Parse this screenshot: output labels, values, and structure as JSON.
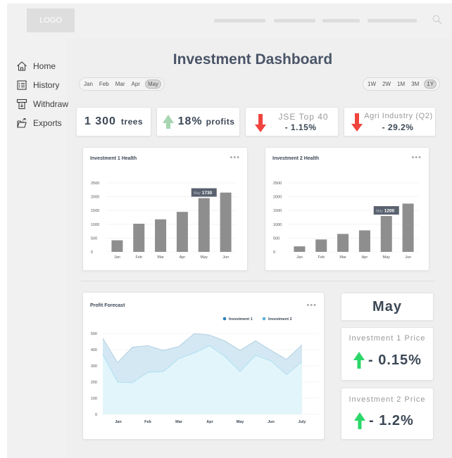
{
  "header": {
    "logo_text": "LOGO"
  },
  "sidebar": {
    "items": [
      {
        "label": "Home",
        "icon": "home-icon"
      },
      {
        "label": "History",
        "icon": "history-icon"
      },
      {
        "label": "Withdraw",
        "icon": "withdraw-icon"
      },
      {
        "label": "Exports",
        "icon": "export-icon"
      }
    ]
  },
  "main": {
    "title": "Investment Dashboard",
    "months": [
      "Jan",
      "Feb",
      "Mar",
      "Apr",
      "May"
    ],
    "active_month": "May",
    "ranges": [
      "1W",
      "2W",
      "1M",
      "3M",
      "1Y"
    ],
    "active_range": "1Y"
  },
  "stats": {
    "trees": {
      "value": "1 300",
      "label": "trees"
    },
    "profits": {
      "value": "18%",
      "label": "profits"
    },
    "jse": {
      "title": "JSE Top 40",
      "value": "- 1.15%"
    },
    "agri": {
      "title": "Agri Industry (Q2)",
      "value": "- 29.2%"
    }
  },
  "colors": {
    "up_arrow_light": "#a8d5b1",
    "up_arrow_green": "#2bd768",
    "down_arrow_red": "#f0443e",
    "bar_gray": "#8e8e8e",
    "tooltip_bg": "#5a6270",
    "investment1": "#2f7fb6",
    "investment2": "#5ab0d8"
  },
  "forecast_month": "May",
  "prices": {
    "inv1": {
      "title": "Investment 1 Price",
      "value": "- 0.15%"
    },
    "inv2": {
      "title": "Investment 2 Price",
      "value": "- 1.2%"
    }
  },
  "chart_data": [
    {
      "type": "bar",
      "title": "Investment 1 Health",
      "categories": [
        "Jan",
        "Feb",
        "Mar",
        "Apr",
        "May",
        "Jun"
      ],
      "values": [
        420,
        1020,
        1180,
        1450,
        1950,
        2150
      ],
      "ylim": [
        0,
        2500
      ],
      "yticks": [
        0,
        500,
        1000,
        1500,
        2000,
        2500
      ],
      "tooltip": {
        "category": "May",
        "label": "May",
        "value": "1730"
      }
    },
    {
      "type": "bar",
      "title": "Investment 2 Health",
      "categories": [
        "Jan",
        "Feb",
        "Mar",
        "Apr",
        "May",
        "Jun"
      ],
      "values": [
        200,
        450,
        650,
        780,
        1300,
        1750
      ],
      "ylim": [
        0,
        2500
      ],
      "yticks": [
        0,
        500,
        1000,
        1500,
        2000,
        2500
      ],
      "tooltip": {
        "category": "May",
        "label": "May",
        "value": "1200"
      }
    },
    {
      "type": "area",
      "title": "Profit Forecast",
      "x_ticks": [
        "Jan",
        "Feb",
        "Mar",
        "Apr",
        "May",
        "Jun",
        "July"
      ],
      "ylim": [
        0,
        500
      ],
      "yticks": [
        0,
        100,
        200,
        300,
        400,
        500
      ],
      "legend": "top-right",
      "series": [
        {
          "name": "Investment 1",
          "x": [
            0,
            0.5,
            1,
            1.5,
            2,
            2.5,
            3,
            3.5,
            4,
            4.5,
            5,
            5.5,
            6,
            6.5
          ],
          "values": [
            470,
            320,
            415,
            425,
            395,
            420,
            500,
            490,
            455,
            395,
            455,
            395,
            340,
            430
          ]
        },
        {
          "name": "Investment 2",
          "x": [
            0,
            0.5,
            1,
            1.5,
            2,
            2.5,
            3,
            3.5,
            4,
            4.5,
            5,
            5.5,
            6,
            6.5
          ],
          "values": [
            370,
            200,
            195,
            260,
            265,
            345,
            380,
            425,
            360,
            265,
            365,
            330,
            245,
            325
          ]
        }
      ]
    }
  ]
}
